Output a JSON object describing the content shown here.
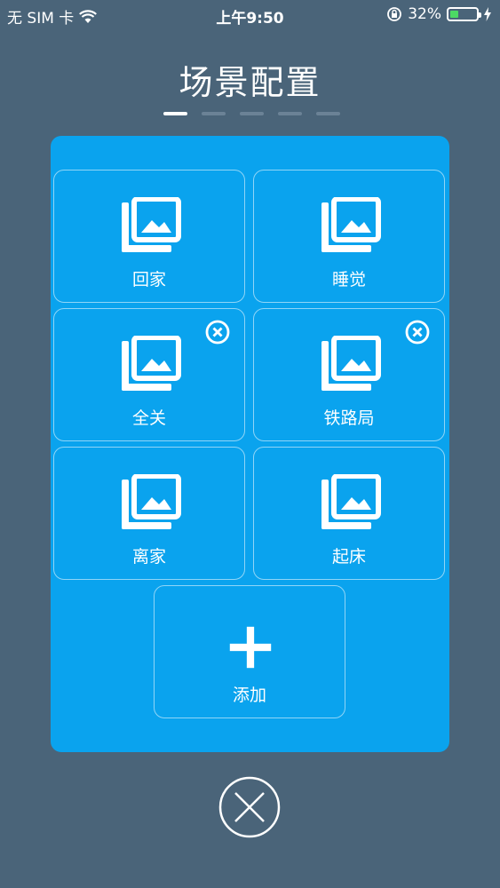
{
  "status_bar": {
    "carrier": "无 SIM 卡",
    "time": "上午9:50",
    "battery_percent": "32%",
    "battery_level": 0.32
  },
  "title": "场景配置",
  "pager": {
    "pages": 5,
    "active": 0
  },
  "scenes": [
    {
      "label": "回家",
      "icon": "image-stack-icon",
      "deletable": false
    },
    {
      "label": "睡觉",
      "icon": "image-stack-icon",
      "deletable": false
    },
    {
      "label": "全关",
      "icon": "image-stack-icon",
      "deletable": true
    },
    {
      "label": "铁路局",
      "icon": "image-stack-icon",
      "deletable": true
    },
    {
      "label": "离家",
      "icon": "image-stack-icon",
      "deletable": false
    },
    {
      "label": "起床",
      "icon": "image-stack-icon",
      "deletable": false
    }
  ],
  "add_tile": {
    "label": "添加",
    "icon": "plus-icon"
  },
  "colors": {
    "background": "#4a6479",
    "panel": "#0aa3ee",
    "battery": "#4cd964"
  }
}
